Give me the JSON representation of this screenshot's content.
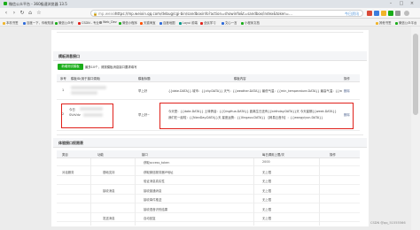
{
  "window": {
    "title": "微信公众平台 - 360极速浏览器 13.5"
  },
  "address_bar": {
    "protocol": "mp.weixin",
    "url": "https://mp.weixin.qq.com/debug/cgi-bin/sandboxinfo?action=showinfo&t=sandbox/index&token=…",
    "search_hint": "今日资讯"
  },
  "bookmarks": [
    {
      "label": "本机书签",
      "color": "#f0b429"
    },
    {
      "label": "百度一下，你就知道",
      "color": "#2f6bd9"
    },
    {
      "label": "微信公众号",
      "color": "#1aad19"
    },
    {
      "label": "CSDN - 专业",
      "color": "#e0211b"
    },
    {
      "label": "Web_Dev",
      "color": "#888888"
    },
    {
      "label": "微信小程序",
      "color": "#1aad19"
    },
    {
      "label": "天猫淘宝",
      "color": "#ff5000"
    },
    {
      "label": "百度地图",
      "color": "#2f6bd9"
    },
    {
      "label": "Layui 前端",
      "color": "#009688"
    },
    {
      "label": "全民学习",
      "color": "#e0211b"
    },
    {
      "label": "文心一言",
      "color": "#2f6bd9"
    },
    {
      "label": "小程序文档",
      "color": "#1aad19"
    },
    {
      "label": "其他书签",
      "color": "#f0b429"
    },
    {
      "label": "微信公众平台",
      "color": "#1aad19"
    }
  ],
  "template_section": {
    "heading": "模板消息接口",
    "add_button": "新增测试模板",
    "note": "模板消息接口让公众号可以向关注其账号的用户发送预设模板的消息",
    "limit_note": "最多10个，请按模板消息接口要求填写",
    "columns": [
      "序号",
      "模板ID(用于接口调用)",
      "模板标题",
      "模板内容",
      "操作"
    ],
    "rows": [
      {
        "index": "1",
        "template_title": "早上好",
        "template_content": "{{date.DATA}} 城市：{{city.DATA}} 天气：{{weather.DATA}} 最低气温：{{min_temperature.DATA}} 最高气温：{{max_temperature.DATA}} 今天是我们恋爱的第{{love_day.DATA}}天 {{birthday.DATA}} {{en_sentence.DATA}} {{zh_sentence.DATA}}",
        "action": "删除"
      },
      {
        "index": "2",
        "template_id_line1": "今日",
        "template_id_line2": "SVzVdv",
        "template_title": "早上好~",
        "template_content_lines": [
          "今天是：{{date.DATA}} 土味情话：{{QingHua.DATA}} 距离生日还有{{birthday.DATA}}天 今天星期{{week.DATA}}",
          "我们在一起啦：{{NianDay.DATA}}天 星座运势：{{Xingzuo.DATA}} 【网易云音乐】：{{wangyiyun.DATA}}"
        ],
        "action": "删除"
      }
    ]
  },
  "permission_section": {
    "heading": "体验接口权限表",
    "columns": [
      "类目",
      "功能",
      "接口",
      "每日调用上限/次",
      "操作"
    ],
    "rows": [
      {
        "category": "",
        "feature": "",
        "api": "获取access_token",
        "limit": "2000",
        "action": ""
      },
      {
        "category": "对话服务",
        "feature": "基础支持",
        "api": "获取微信服务器IP地址",
        "limit": "无上限",
        "action": ""
      },
      {
        "category": "",
        "feature": "",
        "api": "验证消息真实性",
        "limit": "无上限",
        "action": ""
      },
      {
        "category": "",
        "feature": "接收消息",
        "api": "接收普通消息",
        "limit": "无上限",
        "action": ""
      },
      {
        "category": "",
        "feature": "",
        "api": "接收事件推送",
        "limit": "无上限",
        "action": ""
      },
      {
        "category": "",
        "feature": "",
        "api": "接收语音识别结果",
        "limit": "无上限",
        "action": ""
      },
      {
        "category": "",
        "feature": "发送消息",
        "api": "自动回复",
        "limit": "无上限",
        "action": ""
      }
    ]
  },
  "watermark": "CSDN @qq_51555566"
}
